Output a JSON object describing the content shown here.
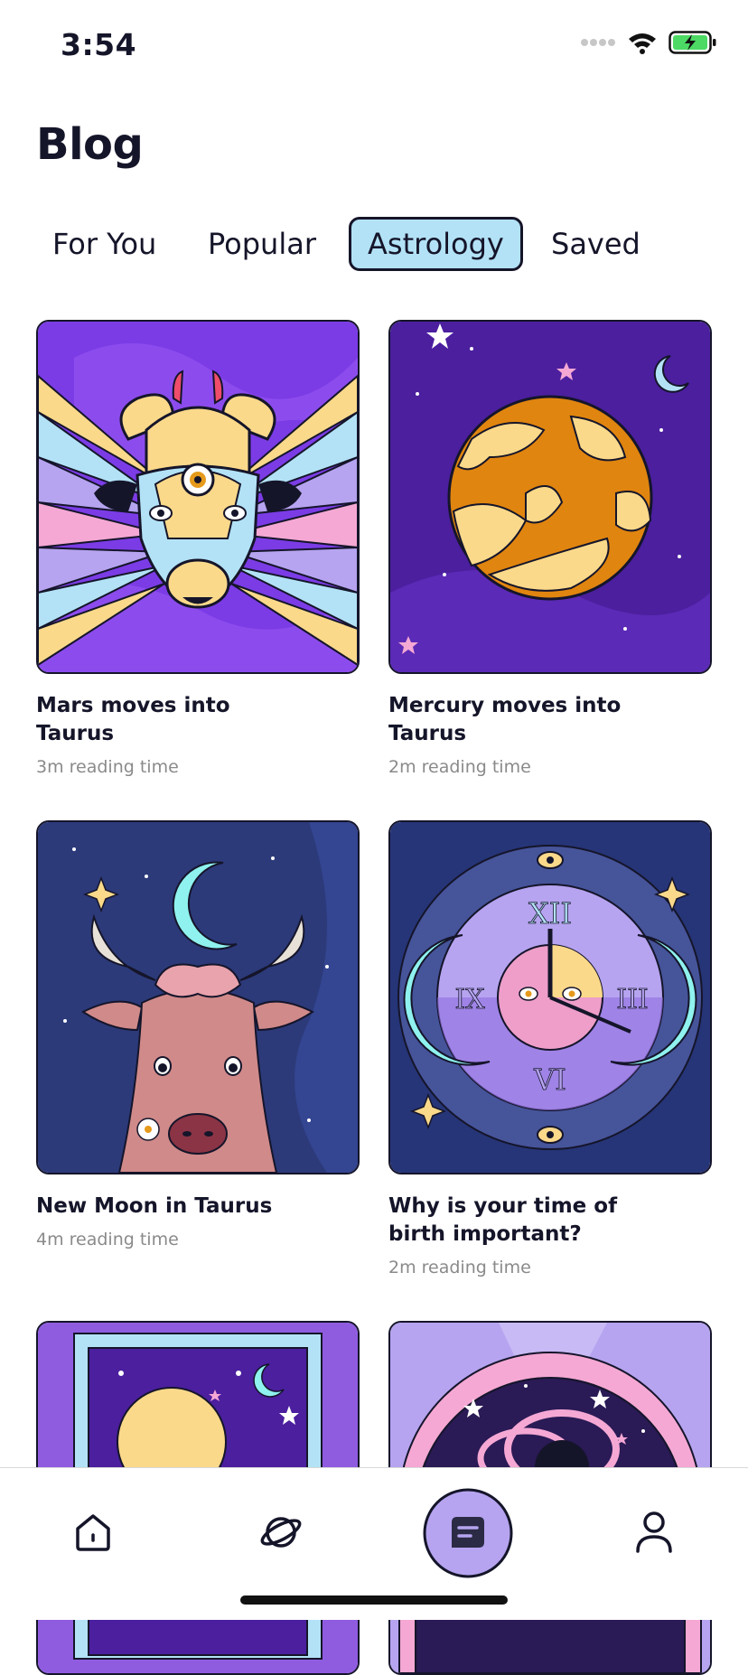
{
  "status_bar": {
    "time": "3:54"
  },
  "header": {
    "title": "Blog"
  },
  "tabs": [
    {
      "label": "For You",
      "active": false
    },
    {
      "label": "Popular",
      "active": false
    },
    {
      "label": "Astrology",
      "active": true
    },
    {
      "label": "Saved",
      "active": false
    }
  ],
  "articles": [
    {
      "title": "Mars moves into Taurus",
      "meta": "3m reading time",
      "image": "taurus-bull-third-eye-illustration"
    },
    {
      "title": "Mercury moves into Taurus",
      "meta": "2m reading time",
      "image": "orange-planet-illustration"
    },
    {
      "title": "New Moon in Taurus",
      "meta": "4m reading time",
      "image": "bull-and-crescent-moon-illustration"
    },
    {
      "title": "Why is your time of birth important?",
      "meta": "2m reading time",
      "image": "moon-clock-illustration"
    },
    {
      "title": "",
      "meta": "",
      "image": "full-moon-window-illustration"
    },
    {
      "title": "",
      "meta": "",
      "image": "cosmic-ring-illustration"
    }
  ],
  "bottom_nav": [
    {
      "icon": "home-icon",
      "active": false
    },
    {
      "icon": "planet-icon",
      "active": false
    },
    {
      "icon": "blog-icon",
      "active": true
    },
    {
      "icon": "profile-icon",
      "active": false
    }
  ],
  "colors": {
    "active_tab": "#b3e2f6",
    "active_nav": "#b6a4f0",
    "text": "#15152a",
    "meta_text": "#8a8a8a"
  }
}
